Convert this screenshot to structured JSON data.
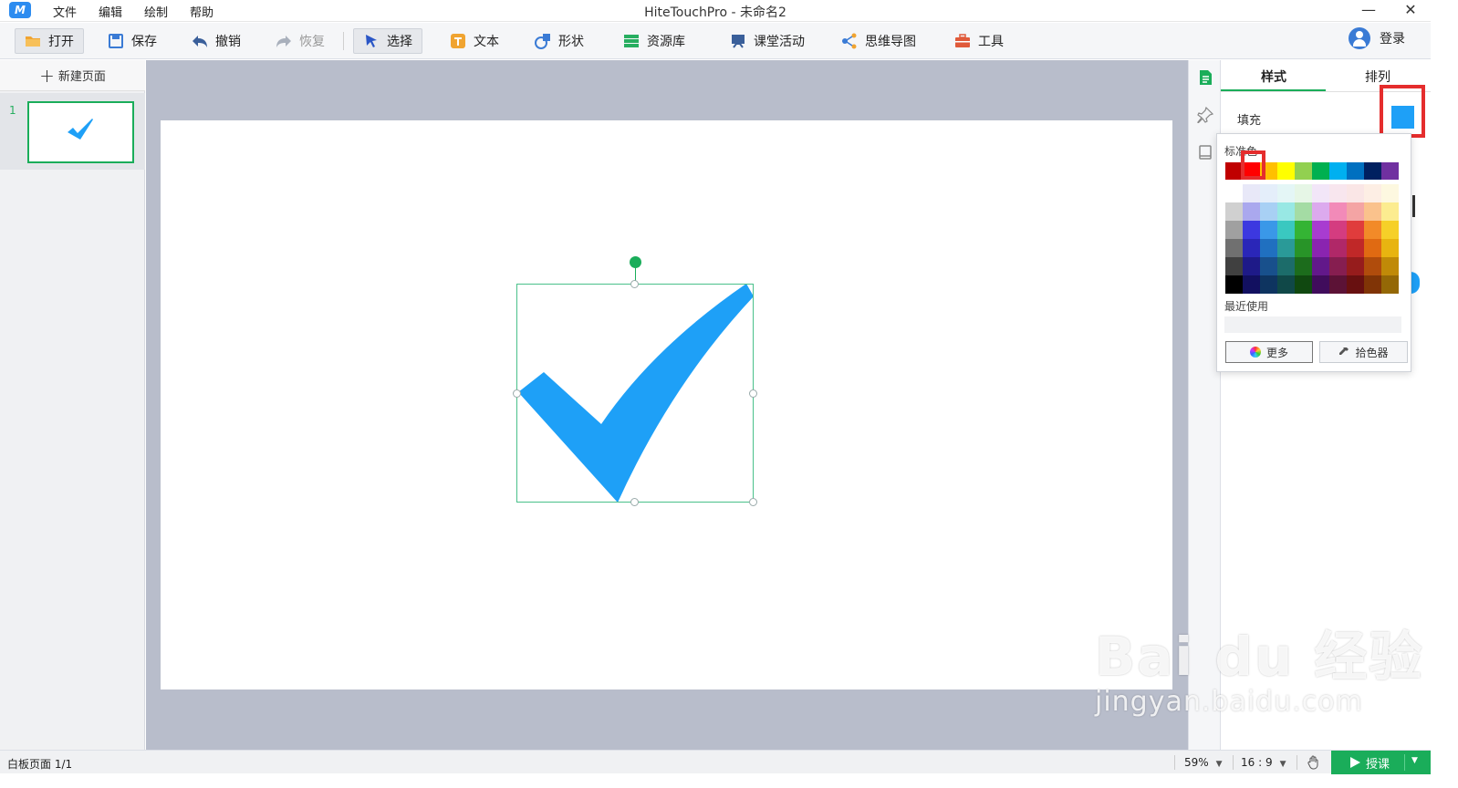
{
  "window": {
    "title": "HiteTouchPro - 未命名2"
  },
  "menu": [
    "文件",
    "编辑",
    "绘制",
    "帮助"
  ],
  "toolbar": {
    "open": "打开",
    "save": "保存",
    "undo": "撤销",
    "redo": "恢复",
    "select": "选择",
    "text": "文本",
    "shape": "形状",
    "resources": "资源库",
    "activity": "课堂活动",
    "mindmap": "思维导图",
    "tools": "工具",
    "login": "登录"
  },
  "pages": {
    "new_page": "新建页面",
    "items": [
      {
        "number": "1"
      }
    ]
  },
  "properties": {
    "tab_style": "样式",
    "tab_arrange": "排列",
    "fill_label": "填充",
    "fill_color": "#1ea0f7"
  },
  "color_picker": {
    "standard_title": "标准色",
    "standard_colors": [
      "#c00000",
      "#ff0000",
      "#ffc000",
      "#ffff00",
      "#92d050",
      "#00b050",
      "#00b0f0",
      "#0070c0",
      "#002060",
      "#7030a0"
    ],
    "recent_title": "最近使用",
    "more_button": "更多",
    "eyedropper_button": "拾色器"
  },
  "statusbar": {
    "page_info": "白板页面 1/1",
    "zoom": "59%",
    "ratio": "16 : 9",
    "teach_button": "授课"
  },
  "watermark": {
    "main": "Bai du 经验",
    "sub": "jingyan.baidu.com"
  },
  "accent_color": "#1aad5a",
  "icons": [
    "folder-icon",
    "save-icon",
    "undo-icon",
    "redo-icon",
    "cursor-icon",
    "text-icon",
    "shape-icon",
    "resource-icon",
    "activity-icon",
    "mindmap-icon",
    "toolbox-icon",
    "user-icon"
  ]
}
